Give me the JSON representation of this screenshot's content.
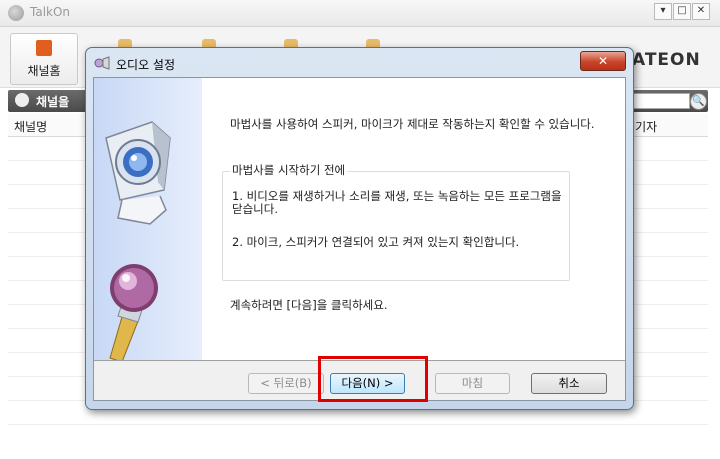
{
  "app": {
    "title": "TalkOn",
    "brand_prefix": "",
    "brand": "ATEON",
    "window_controls": [
      "▾",
      "□",
      "✕"
    ]
  },
  "toolbar": {
    "channel_home_label": "채널홈"
  },
  "channel_bar": {
    "label": "채널을"
  },
  "list_header": {
    "col_name": "채널명",
    "col_waiting": "/대기자"
  },
  "dialog": {
    "title": "오디오 설정",
    "close_glyph": "✕",
    "intro": "마법사를 사용하여 스피커, 마이크가 제대로 작동하는지 확인할 수 있습니다.",
    "group_title": "마법사를 시작하기 전에",
    "step1": "1. 비디오를 재생하거나 소리를 재생, 또는 녹음하는 모든 프로그램을 닫습니다.",
    "step2": "2. 마이크, 스피커가 연결되어 있고 켜져 있는지 확인합니다.",
    "continue_text": "계속하려면 [다음]을 클릭하세요.",
    "buttons": {
      "back": "< 뒤로(B)",
      "next": "다음(N) >",
      "finish": "마침",
      "cancel": "취소"
    }
  },
  "icons": [
    "app-logo-icon",
    "channel-home-icon",
    "search-icon",
    "wizard-icon",
    "camera-icon",
    "microphone-icon",
    "close-icon"
  ],
  "colors": {
    "accent": "#e35a25",
    "highlight_box": "#e00000"
  }
}
